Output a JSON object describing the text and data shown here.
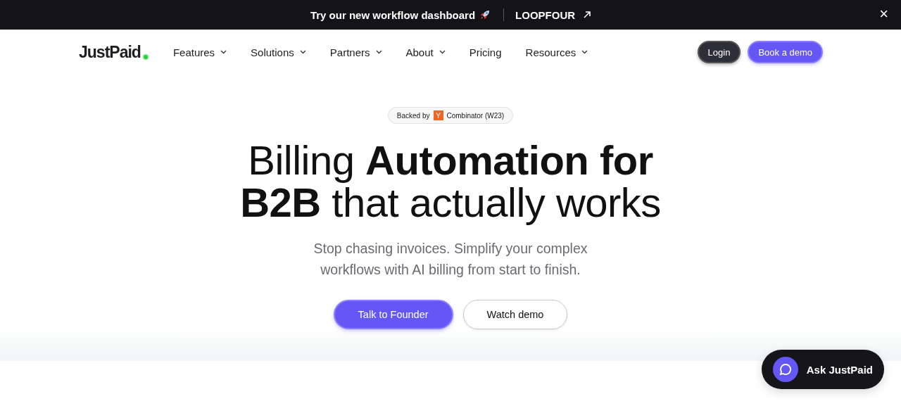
{
  "announcement": {
    "text": "Try our new workflow dashboard",
    "link": "LOOPFOUR",
    "close": "×"
  },
  "header": {
    "logo": "JustPaid",
    "nav": [
      {
        "label": "Features",
        "has_menu": true
      },
      {
        "label": "Solutions",
        "has_menu": true
      },
      {
        "label": "Partners",
        "has_menu": true
      },
      {
        "label": "About",
        "has_menu": true
      },
      {
        "label": "Pricing",
        "has_menu": false
      },
      {
        "label": "Resources",
        "has_menu": true
      }
    ],
    "buttons": [
      {
        "label": "Login",
        "kind": "dark"
      },
      {
        "label": "Book a demo",
        "kind": "primary"
      }
    ]
  },
  "hero": {
    "badge": {
      "before": "Backed by",
      "mark": "Y",
      "after": "Combinator (W23)"
    },
    "headline_lines": [
      "Billing **Automation for**",
      "**B2B** that actually works"
    ],
    "subtitle": "Stop chasing invoices. Simplify your complex workflows with AI billing from start to finish.",
    "buttons": [
      {
        "label": "Talk to Founder",
        "kind": "primary"
      },
      {
        "label": "Watch demo",
        "kind": "outline"
      }
    ]
  },
  "chat": {
    "label": "Ask JustPaid"
  }
}
